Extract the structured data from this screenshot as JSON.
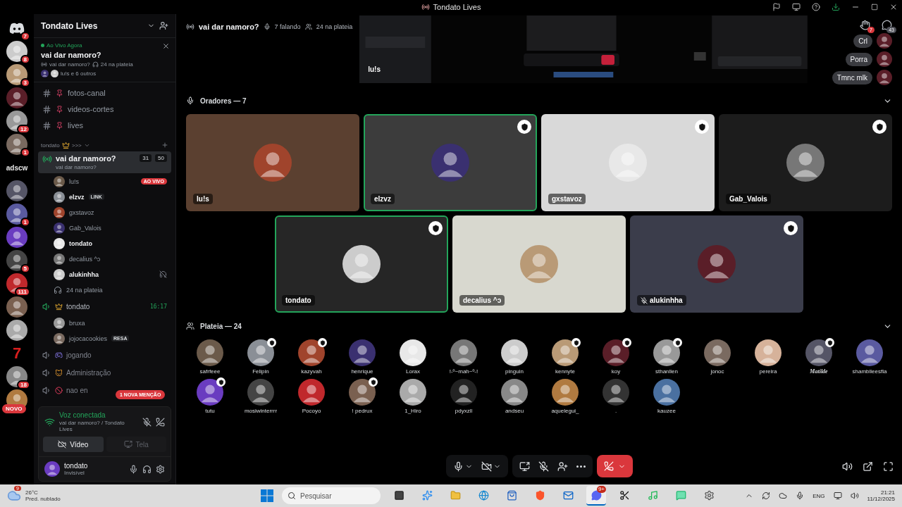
{
  "window": {
    "title": "Tondato Lives"
  },
  "servers": [
    {
      "kind": "home",
      "badge": "7"
    },
    {
      "kind": "server",
      "badge": "8"
    },
    {
      "kind": "server",
      "badge": "3"
    },
    {
      "kind": "server"
    },
    {
      "kind": "server",
      "badge": "12"
    },
    {
      "kind": "server",
      "badge": "1"
    },
    {
      "kind": "text",
      "label": "adscw",
      "color": "#e8e8e8"
    },
    {
      "kind": "server"
    },
    {
      "kind": "server",
      "badge": "1"
    },
    {
      "kind": "server"
    },
    {
      "kind": "server",
      "badge": "5"
    },
    {
      "kind": "server",
      "badge": "111"
    },
    {
      "kind": "server"
    },
    {
      "kind": "server"
    },
    {
      "kind": "text",
      "label": "7",
      "color": "#d81e1e"
    },
    {
      "kind": "server",
      "badge": "18"
    },
    {
      "kind": "server",
      "pill": "NOVO"
    }
  ],
  "sidebar": {
    "server_name": "Tondato Lives",
    "live_banner": {
      "status": "Ao Vivo Agora",
      "title": "vai dar namoro?",
      "channel": "vai dar namoro?",
      "audience": "24 na plateia",
      "participants": "lu!s e 6 outros"
    },
    "channels": [
      {
        "name": "fotos-canal"
      },
      {
        "name": "videos-cortes"
      },
      {
        "name": "lives"
      }
    ],
    "category": {
      "name": "tondato",
      "kind": "crown",
      "suffix": ">>>"
    },
    "stage": {
      "name": "vai dar namoro?",
      "topic": "vai dar namoro?",
      "video_count": "31",
      "limit": "50",
      "selected": true,
      "members": [
        {
          "name": "lu!s",
          "highlighted": false,
          "live": "AO VIVO",
          "deafened": false
        },
        {
          "name": "elzvz",
          "highlighted": true,
          "tag": "LINK",
          "deafened": false
        },
        {
          "name": "gxstavoz",
          "highlighted": false,
          "deafened": false
        },
        {
          "name": "Gab_Valois",
          "highlighted": false,
          "deafened": false
        },
        {
          "name": "tondato",
          "highlighted": true,
          "deafened": false
        },
        {
          "name": "decalius ^ↄ",
          "highlighted": false,
          "deafened": false
        },
        {
          "name": "alukinhha",
          "highlighted": true,
          "deafened": true
        }
      ],
      "audience": "24 na plateia"
    },
    "voice_channels": [
      {
        "name": "tondato",
        "kind": "crown",
        "active": true,
        "time": "16:17",
        "members": [
          {
            "name": "bruxa"
          },
          {
            "name": "jojocacookies",
            "tag": "RESA"
          }
        ]
      },
      {
        "name": "jogando",
        "kind": "gamepad",
        "active": false
      },
      {
        "name": "Administração",
        "kind": "cat",
        "active": false
      },
      {
        "name": "nao en",
        "kind": "ban",
        "active": false
      }
    ],
    "mention_pill": "1 NOVA MENÇÃO",
    "voice_panel": {
      "status": "Voz conectada",
      "location": "vai dar namoro? / Tondato Lives",
      "buttons": [
        {
          "label": "Vídeo",
          "disabled": false
        },
        {
          "label": "Tela",
          "disabled": true
        }
      ]
    },
    "user": {
      "name": "tondato",
      "status": "Invisível"
    }
  },
  "stage": {
    "title": "vai dar namoro?",
    "speaking": "7 falando",
    "audience": "24 na plateia",
    "stream_label": "lu!s",
    "raised_hands": "7",
    "chat_count": "43",
    "chat": [
      {
        "text": "Crl"
      },
      {
        "text": "Porra"
      },
      {
        "text": "Tmnc mlk"
      }
    ],
    "speakers_heading": "Oradores — 7",
    "speakers": [
      {
        "name": "lu!s",
        "color": "#5b4030",
        "speaking": false,
        "badge": false,
        "muted": false
      },
      {
        "name": "elzvz",
        "color": "#3c3c3c",
        "speaking": true,
        "badge": true,
        "muted": false
      },
      {
        "name": "gxstavoz",
        "color": "#d9d9d9",
        "speaking": false,
        "badge": true,
        "muted": false
      },
      {
        "name": "Gab_Valois",
        "color": "#1c1c1c",
        "speaking": false,
        "badge": true,
        "muted": false
      },
      {
        "name": "tondato",
        "color": "#262626",
        "speaking": true,
        "badge": true,
        "muted": false
      },
      {
        "name": "decalius ^ↄ",
        "color": "#d8d8cf",
        "speaking": false,
        "badge": false,
        "muted": false
      },
      {
        "name": "alukinhha",
        "color": "#3b3d4b",
        "speaking": false,
        "badge": true,
        "muted": true
      }
    ],
    "audience_heading": "Plateia — 24",
    "audience_members": [
      {
        "name": "safrfeee",
        "badge": false
      },
      {
        "name": "Felipin",
        "badge": true
      },
      {
        "name": "kazyvah",
        "badge": true
      },
      {
        "name": "henrique",
        "badge": false
      },
      {
        "name": "Lorax",
        "badge": false
      },
      {
        "name": "!-º~mah~º-!",
        "badge": false
      },
      {
        "name": "pinguin",
        "badge": false
      },
      {
        "name": "kennyte",
        "badge": true
      },
      {
        "name": "koy",
        "badge": true
      },
      {
        "name": "sthanllen",
        "badge": true
      },
      {
        "name": "jonoc",
        "badge": false
      },
      {
        "name": "pereira",
        "badge": false
      },
      {
        "name": "Matilde",
        "badge": true,
        "fancy": true
      },
      {
        "name": "shamblleesfla",
        "badge": false
      },
      {
        "name": "tutu",
        "badge": true
      },
      {
        "name": "mosiwinterrrr",
        "badge": false
      },
      {
        "name": "Pocoyo",
        "badge": false
      },
      {
        "name": "! pedrux",
        "badge": true
      },
      {
        "name": "1_Hiro",
        "badge": false
      },
      {
        "name": "pdyxzll",
        "badge": false
      },
      {
        "name": "andseu",
        "badge": false
      },
      {
        "name": "aquelegui_",
        "badge": false
      },
      {
        "name": ".",
        "badge": false
      },
      {
        "name": "kauzee",
        "badge": false
      }
    ]
  },
  "taskbar": {
    "weather": {
      "temp": "26°C",
      "desc": "Pred. nublado",
      "badge": "9"
    },
    "search": {
      "placeholder": "Pesquisar"
    },
    "apps": [
      {
        "kind": "taskview",
        "active": false
      },
      {
        "kind": "copilot",
        "active": false
      },
      {
        "kind": "folder",
        "active": false
      },
      {
        "kind": "edge",
        "active": false
      },
      {
        "kind": "store",
        "active": false
      },
      {
        "kind": "brave",
        "active": false
      },
      {
        "kind": "outlook",
        "active": false
      },
      {
        "kind": "discord",
        "active": true,
        "badge": "9+"
      },
      {
        "kind": "capcut",
        "active": false
      },
      {
        "kind": "spotify",
        "active": false
      },
      {
        "kind": "chat",
        "active": false
      },
      {
        "kind": "settings",
        "active": false
      }
    ],
    "tray": {
      "language": "ENG",
      "time": "21:21",
      "date": "11/12/2025"
    }
  }
}
